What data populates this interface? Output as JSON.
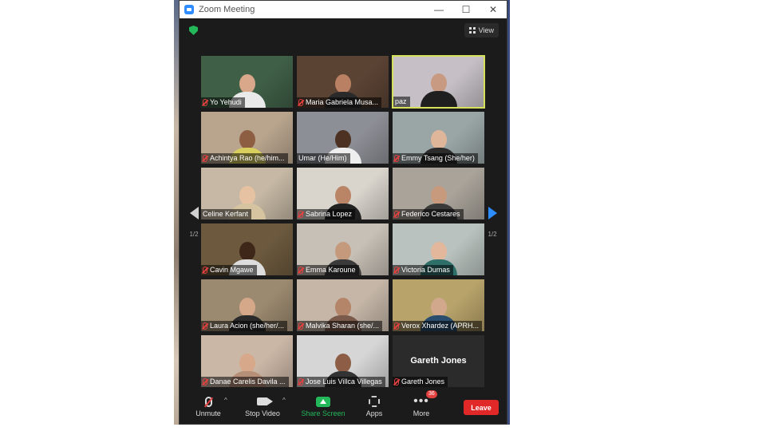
{
  "window": {
    "title": "Zoom Meeting",
    "controls": {
      "minimize": "—",
      "maximize": "☐",
      "close": "✕"
    }
  },
  "topbar": {
    "view_label": "View",
    "security_icon": "shield-icon"
  },
  "pager": {
    "left_label": "1/2",
    "right_label": "1/2"
  },
  "participants": [
    {
      "name": "Yo Yehudi",
      "muted": true,
      "bg": "#3f5f47",
      "skin": "#d9a78a",
      "shirt": "#e9e9e9"
    },
    {
      "name": "Maria Gabriela Musa...",
      "muted": true,
      "bg": "#5b4334",
      "skin": "#b98063",
      "shirt": "#2a2a2a"
    },
    {
      "name": "paz",
      "muted": false,
      "active": true,
      "bg": "#c6c0c6",
      "skin": "#c99a82",
      "shirt": "#1f1f1f"
    },
    {
      "name": "Achintya Rao (he/him...",
      "muted": true,
      "bg": "#b9a58e",
      "skin": "#8e5e42",
      "shirt": "#d9cf5f"
    },
    {
      "name": "Umar (He/Him)",
      "muted": false,
      "bg": "#8c8f95",
      "skin": "#4d3122",
      "shirt": "#eeeeee"
    },
    {
      "name": "Emmy Tsang (She/her)",
      "muted": true,
      "bg": "#9aa6a6",
      "skin": "#e0b69a",
      "shirt": "#2c2c2c"
    },
    {
      "name": "Celine Kerfant",
      "muted": false,
      "bg": "#c6b8a4",
      "skin": "#e7c2a2",
      "shirt": "#d6c39f"
    },
    {
      "name": "Sabrina Lopez",
      "muted": true,
      "bg": "#d9d4cc",
      "skin": "#b98566",
      "shirt": "#222222"
    },
    {
      "name": "Federico Cestares",
      "muted": true,
      "bg": "#a9a39a",
      "skin": "#c79a7e",
      "shirt": "#3a3a3a"
    },
    {
      "name": "Cavin Mgawe",
      "muted": true,
      "bg": "#6d5a3e",
      "skin": "#3e2718",
      "shirt": "#dddddd"
    },
    {
      "name": "Emma Karoune",
      "muted": true,
      "bg": "#c7c0b6",
      "skin": "#c59a7c",
      "shirt": "#3a3a3a"
    },
    {
      "name": "Victoria Dumas",
      "muted": true,
      "bg": "#b9c2be",
      "skin": "#e2b79b",
      "shirt": "#2f6f6a"
    },
    {
      "name": "Laura Acion (she/her/...",
      "muted": true,
      "bg": "#9c8a70",
      "skin": "#d6a88a",
      "shirt": "#2a2a2a"
    },
    {
      "name": "Malvika Sharan (she/...",
      "muted": true,
      "bg": "#c5b6a7",
      "skin": "#b5856a",
      "shirt": "#7a5a4a"
    },
    {
      "name": "Verox Xhardez (APRH...",
      "muted": true,
      "bg": "#b8a36a",
      "skin": "#d2a88c",
      "shirt": "#2a4d6e"
    },
    {
      "name": "Danae Carelis Davila ...",
      "muted": true,
      "bg": "#cbb7a6",
      "skin": "#d8a88a",
      "shirt": "#b58f78"
    },
    {
      "name": "Jose Luis Villca Villegas",
      "muted": true,
      "bg": "#d6d6d6",
      "skin": "#8d5e45",
      "shirt": "#333333"
    },
    {
      "name": "Gareth Jones",
      "muted": true,
      "no_video": true,
      "center_name": "Gareth Jones"
    }
  ],
  "toolbar": {
    "unmute_label": "Unmute",
    "stop_video_label": "Stop Video",
    "share_screen_label": "Share Screen",
    "apps_label": "Apps",
    "more_label": "More",
    "more_badge": "36",
    "leave_label": "Leave",
    "caret": "^"
  }
}
